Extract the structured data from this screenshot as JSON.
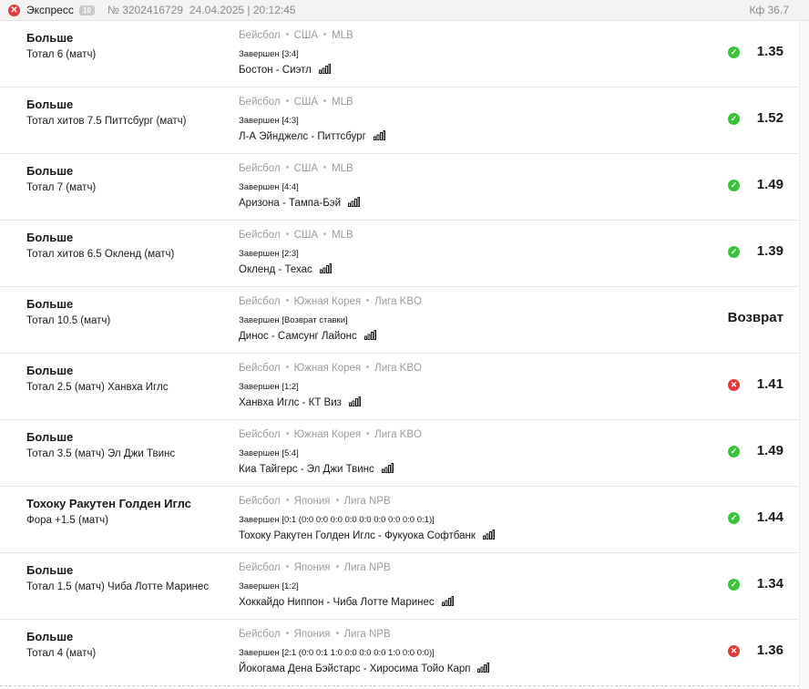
{
  "header": {
    "type": "Экспресс",
    "count": "10",
    "number": "№ 3202416729",
    "datetime": "24.04.2025 | 20:12:45",
    "kf": "Кф 36.7"
  },
  "bets": [
    {
      "outcome": "Больше",
      "market": "Тотал 6 (матч)",
      "sport": "Бейсбол",
      "country": "США",
      "league": "MLB",
      "status": "Завершен [3:4]",
      "match": "Бостон - Сиэтл",
      "result": "win",
      "odds": "1.35"
    },
    {
      "outcome": "Больше",
      "market": "Тотал хитов 7.5 Питтсбург (матч)",
      "sport": "Бейсбол",
      "country": "США",
      "league": "MLB",
      "status": "Завершен [4:3]",
      "match": "Л-А Эйнджелс - Питтсбург",
      "result": "win",
      "odds": "1.52"
    },
    {
      "outcome": "Больше",
      "market": "Тотал 7 (матч)",
      "sport": "Бейсбол",
      "country": "США",
      "league": "MLB",
      "status": "Завершен [4:4]",
      "match": "Аризона - Тампа-Бэй",
      "result": "win",
      "odds": "1.49"
    },
    {
      "outcome": "Больше",
      "market": "Тотал хитов 6.5 Окленд (матч)",
      "sport": "Бейсбол",
      "country": "США",
      "league": "MLB",
      "status": "Завершен [2:3]",
      "match": "Окленд - Техас",
      "result": "win",
      "odds": "1.39"
    },
    {
      "outcome": "Больше",
      "market": "Тотал 10.5 (матч)",
      "sport": "Бейсбол",
      "country": "Южная Корея",
      "league": "Лига KBO",
      "status": "Завершен [Возврат ставки]",
      "match": "Динос - Самсунг Лайонс",
      "result": "refund",
      "odds": "Возврат"
    },
    {
      "outcome": "Больше",
      "market": "Тотал 2.5 (матч) Ханвха Иглс",
      "sport": "Бейсбол",
      "country": "Южная Корея",
      "league": "Лига KBO",
      "status": "Завершен [1:2]",
      "match": "Ханвха Иглс - КТ Виз",
      "result": "lose",
      "odds": "1.41"
    },
    {
      "outcome": "Больше",
      "market": "Тотал 3.5 (матч) Эл Джи Твинс",
      "sport": "Бейсбол",
      "country": "Южная Корея",
      "league": "Лига KBO",
      "status": "Завершен [5:4]",
      "match": "Киа Тайгерс - Эл Джи Твинс",
      "result": "win",
      "odds": "1.49"
    },
    {
      "outcome": "Тохоку Ракутен Голден Иглс",
      "market": "Фора +1.5 (матч)",
      "sport": "Бейсбол",
      "country": "Япония",
      "league": "Лига NPB",
      "status": "Завершен [0:1 (0:0 0:0 0:0 0:0 0:0 0:0 0:0 0:0 0:1)]",
      "match": "Тохоку Ракутен Голден Иглс - Фукуока Софтбанк",
      "result": "win",
      "odds": "1.44"
    },
    {
      "outcome": "Больше",
      "market": "Тотал 1.5 (матч) Чиба Лотте Маринес",
      "sport": "Бейсбол",
      "country": "Япония",
      "league": "Лига NPB",
      "status": "Завершен [1:2]",
      "match": "Хоккайдо Ниппон - Чиба Лотте Маринес",
      "result": "win",
      "odds": "1.34"
    },
    {
      "outcome": "Больше",
      "market": "Тотал 4 (матч)",
      "sport": "Бейсбол",
      "country": "Япония",
      "league": "Лига NPB",
      "status": "Завершен [2:1 (0:0 0:1 1:0 0:0 0:0 0:0 1:0 0:0 0:0)]",
      "match": "Йокогама Дена Бэйстарс - Хиросима Тойо Карп",
      "result": "lose",
      "odds": "1.36"
    }
  ],
  "colors": {
    "win": "#3cc13b",
    "lose": "#e03a3a",
    "muted": "#9b9ba0"
  },
  "icons": {
    "win": "check-icon",
    "lose": "cross-icon",
    "stats": "stats-bars-icon",
    "close": "close-icon"
  }
}
